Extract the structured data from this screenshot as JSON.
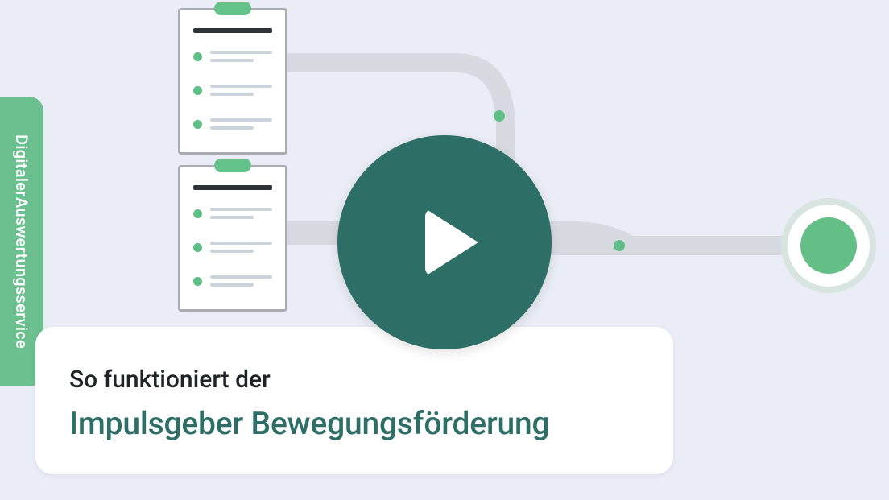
{
  "colors": {
    "background": "#eaedf5",
    "accent_green": "#6cbf8f",
    "dark_teal": "#2d6f66",
    "white": "#ffffff",
    "text_dark": "#1f2429",
    "path_grey": "#d7dbe1",
    "dot_green": "#5fbf87",
    "circle_inner": "#63bf86"
  },
  "side_tab": {
    "line1": "Digitaler",
    "line2": "Auswertungsservice"
  },
  "title_card": {
    "lead": "So funktioniert der",
    "main": "Impulsgeber Bewegungsförderung"
  },
  "play": {
    "label": "Play video"
  },
  "diagram": {
    "clipboard_count": 2,
    "rows_per_clipboard": 3
  }
}
